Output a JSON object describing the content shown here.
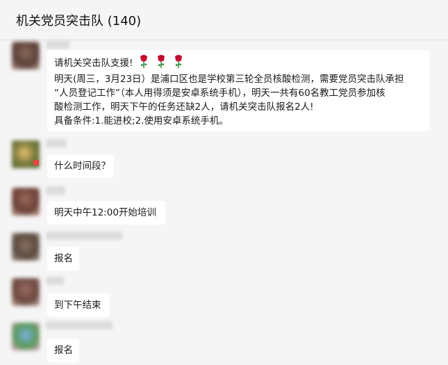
{
  "header": {
    "title": "机关党员突击队 (140)"
  },
  "messages": [
    {
      "lines": [
        "请机关突击队支援!",
        "明天(周三，3月23日）是浦口区也是学校第三轮全员核酸检测，需要党员突击队承担",
        "“人员登记工作”（本人用得须是安卓系统手机），明天一共有60名教工党员参加核",
        "酸检测工作，明天下午的任务还缺2人，请机关突击队报名2人!",
        "具备条件:1.能进校;2.使用安卓系统手机。"
      ],
      "emoji": [
        "rose-icon",
        "rose-icon",
        "rose-icon"
      ]
    },
    {
      "text": "什么时间段？"
    },
    {
      "text": "明天中午12:00开始培训"
    },
    {
      "text": "报名"
    },
    {
      "text": "到下午结束"
    },
    {
      "text": "报名"
    }
  ],
  "colors": {
    "background": "#f5f5f5",
    "bubble": "#ffffff",
    "rose_petal": "#c8102e",
    "rose_leaf": "#2e8b3a"
  }
}
